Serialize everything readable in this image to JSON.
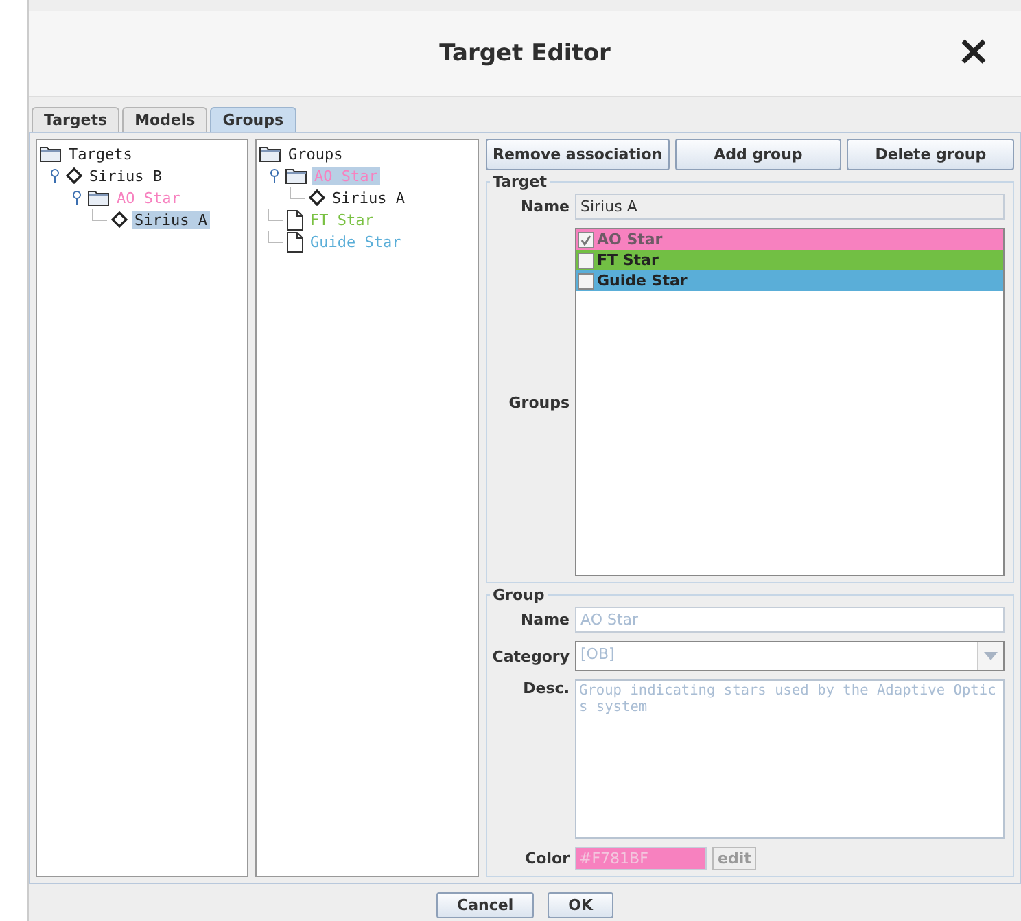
{
  "window": {
    "title": "Target Editor",
    "close": "×"
  },
  "tabs": [
    {
      "label": "Targets",
      "selected": false
    },
    {
      "label": "Models",
      "selected": false
    },
    {
      "label": "Groups",
      "selected": true
    }
  ],
  "targets_tree": {
    "root": "Targets",
    "children": [
      {
        "label": "Sirius B",
        "kind": "target",
        "expanded": true,
        "selected": false,
        "children": [
          {
            "label": "AO Star",
            "kind": "folder",
            "color": "#f781bf",
            "expanded": true,
            "selected": false,
            "children": [
              {
                "label": "Sirius A",
                "kind": "target",
                "selected": true
              }
            ]
          }
        ]
      }
    ]
  },
  "groups_tree": {
    "root": "Groups",
    "children": [
      {
        "label": "AO Star",
        "kind": "folder",
        "color": "#f781bf",
        "expanded": true,
        "selected": true,
        "children": [
          {
            "label": "Sirius A",
            "kind": "target",
            "selected": false
          }
        ]
      },
      {
        "label": "FT Star",
        "kind": "file",
        "color": "#7ac143",
        "selected": false
      },
      {
        "label": "Guide Star",
        "kind": "file",
        "color": "#5aaed8",
        "selected": false
      }
    ]
  },
  "buttons": [
    "Remove association",
    "Add group",
    "Delete group"
  ],
  "target": {
    "title": "Target",
    "name_label": "Name",
    "name": "Sirius A",
    "groups_label": "Groups",
    "groups": [
      {
        "label": "AO Star",
        "color": "#f781bf",
        "checked": true,
        "disabled": true
      },
      {
        "label": "FT Star",
        "color": "#72bf44",
        "checked": false,
        "disabled": false
      },
      {
        "label": "Guide Star",
        "color": "#5aaed8",
        "checked": false,
        "disabled": false
      }
    ]
  },
  "group": {
    "title": "Group",
    "name_label": "Name",
    "name": "AO Star",
    "category_label": "Category",
    "category": "[OB]",
    "desc_label": "Desc.",
    "desc": "Group indicating stars used by the Adaptive Optics system",
    "color_label": "Color",
    "color": "#F781BF",
    "edit": "edit"
  },
  "footer": [
    "Cancel",
    "OK"
  ]
}
